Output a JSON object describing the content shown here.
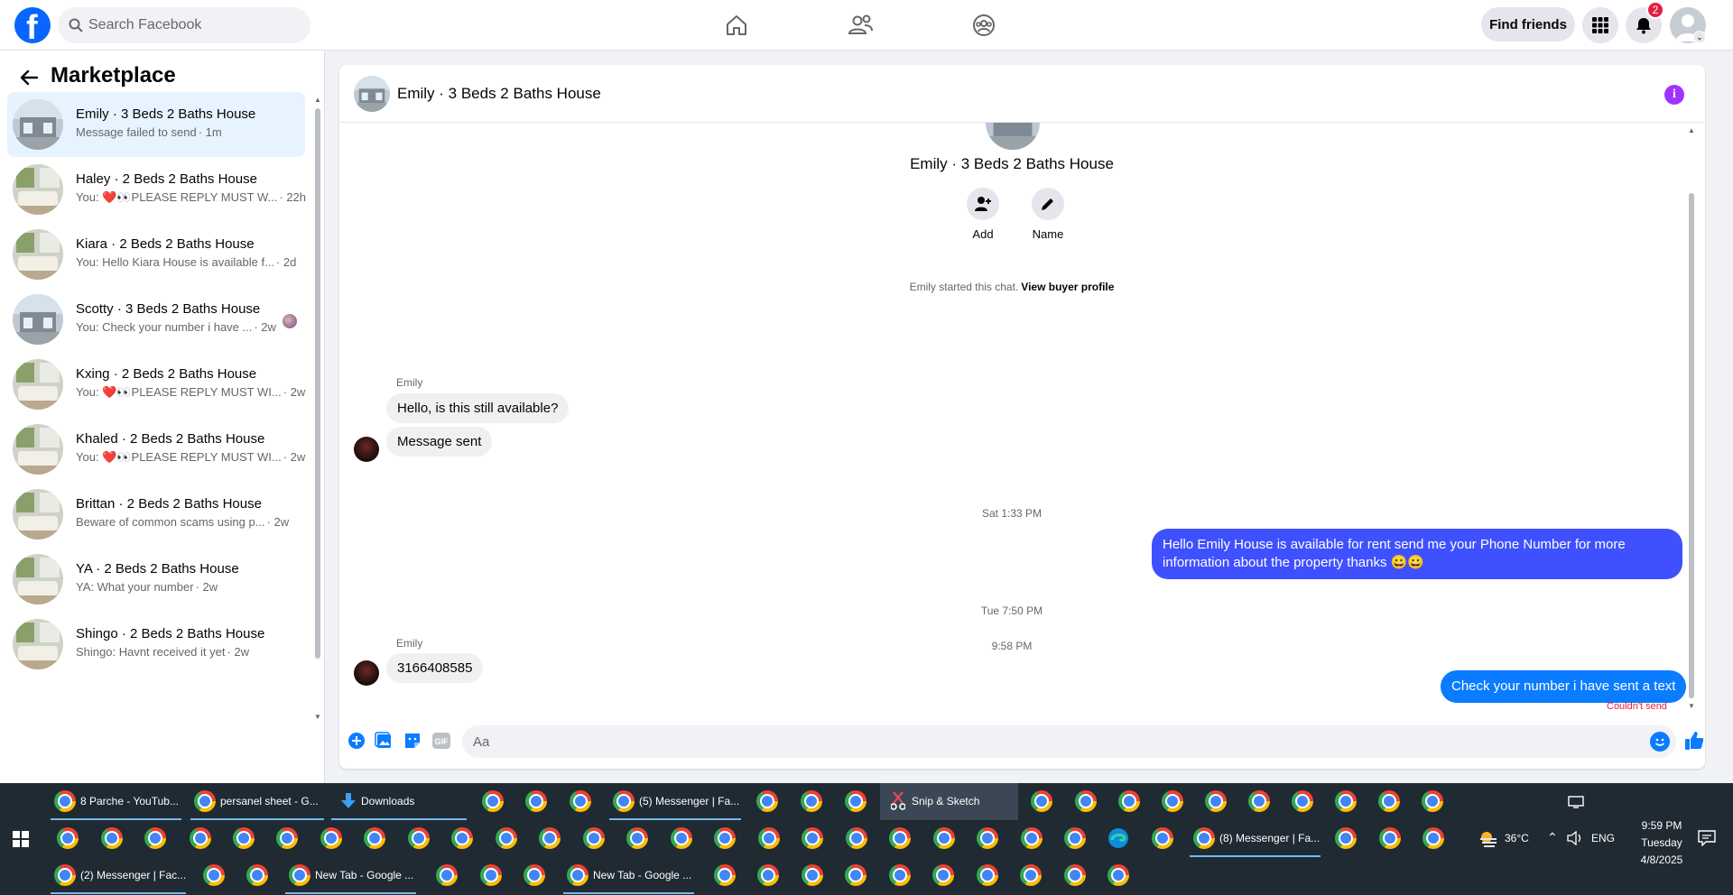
{
  "header": {
    "search_placeholder": "Search Facebook",
    "find_friends_label": "Find friends",
    "notification_count": "2"
  },
  "sidebar": {
    "title": "Marketplace",
    "conversations": [
      {
        "name": "Emily · 3 Beds 2 Baths House",
        "preview": "Message failed to send",
        "time": "· 1m"
      },
      {
        "name": "Haley · 2 Beds 2 Baths House",
        "preview": "You: ❤️👀PLEASE REPLY MUST W...",
        "time": "· 22h"
      },
      {
        "name": "Kiara · 2 Beds 2 Baths House",
        "preview": "You: Hello Kiara House is available f...",
        "time": "· 2d"
      },
      {
        "name": "Scotty · 3 Beds 2 Baths House",
        "preview": "You: Check your number i have ...",
        "time": "· 2w"
      },
      {
        "name": "Kxing · 2 Beds 2 Baths House",
        "preview": "You: ❤️👀PLEASE REPLY MUST WI...",
        "time": "· 2w"
      },
      {
        "name": "Khaled · 2 Beds 2 Baths House",
        "preview": "You: ❤️👀PLEASE REPLY MUST WI...",
        "time": "· 2w"
      },
      {
        "name": "Brittan · 2 Beds 2 Baths House",
        "preview": "Beware of common scams using p...",
        "time": "· 2w"
      },
      {
        "name": "YA · 2 Beds 2 Baths House",
        "preview": "YA: What your number",
        "time": "· 2w"
      },
      {
        "name": "Shingo · 2 Beds 2 Baths House",
        "preview": "Shingo: Havnt received it yet",
        "time": "· 2w"
      }
    ]
  },
  "chat": {
    "title": "Emily · 3 Beds 2 Baths House",
    "profile_name": "Emily · 3 Beds 2 Baths House",
    "add_label": "Add",
    "name_label": "Name",
    "started_text": "Emily started this chat.",
    "view_profile_label": "View buyer profile",
    "sender_name": "Emily",
    "msg_1": "Hello, is this still available?",
    "msg_2": "Message sent",
    "time_1": "Sat 1:33 PM",
    "out_1": "Hello Emily  House is available for rent send me your Phone Number for more information about the property thanks 😀😀",
    "time_2": "Tue 7:50 PM",
    "msg_3": "3166408585",
    "time_3": "9:58 PM",
    "out_2": "Check your number i have sent a text",
    "failed_label": "Couldn't send",
    "input_placeholder": "Aa"
  },
  "taskbar": {
    "row1": [
      {
        "label": "8 Parche - YouTub..."
      },
      {
        "label": "persanel sheet - G..."
      },
      {
        "label": "Downloads"
      },
      {
        "label": "(5) Messenger | Fa..."
      },
      {
        "label": "Snip & Sketch"
      }
    ],
    "row2_task": "(8) Messenger | Fa...",
    "row3": [
      {
        "label": "(2) Messenger | Fac..."
      },
      {
        "label": "New Tab - Google ..."
      },
      {
        "label": "New Tab - Google ..."
      }
    ],
    "weather": "36°C",
    "language": "ENG",
    "time": "9:59 PM",
    "day": "Tuesday",
    "date": "4/8/2025"
  },
  "colors": {
    "brand": "#0866ff",
    "outgoing_bubble": "#0a7cff",
    "outgoing_bubble_alt": "#3f50ff",
    "error": "#e41e3f",
    "taskbar": "#1f2a33"
  }
}
